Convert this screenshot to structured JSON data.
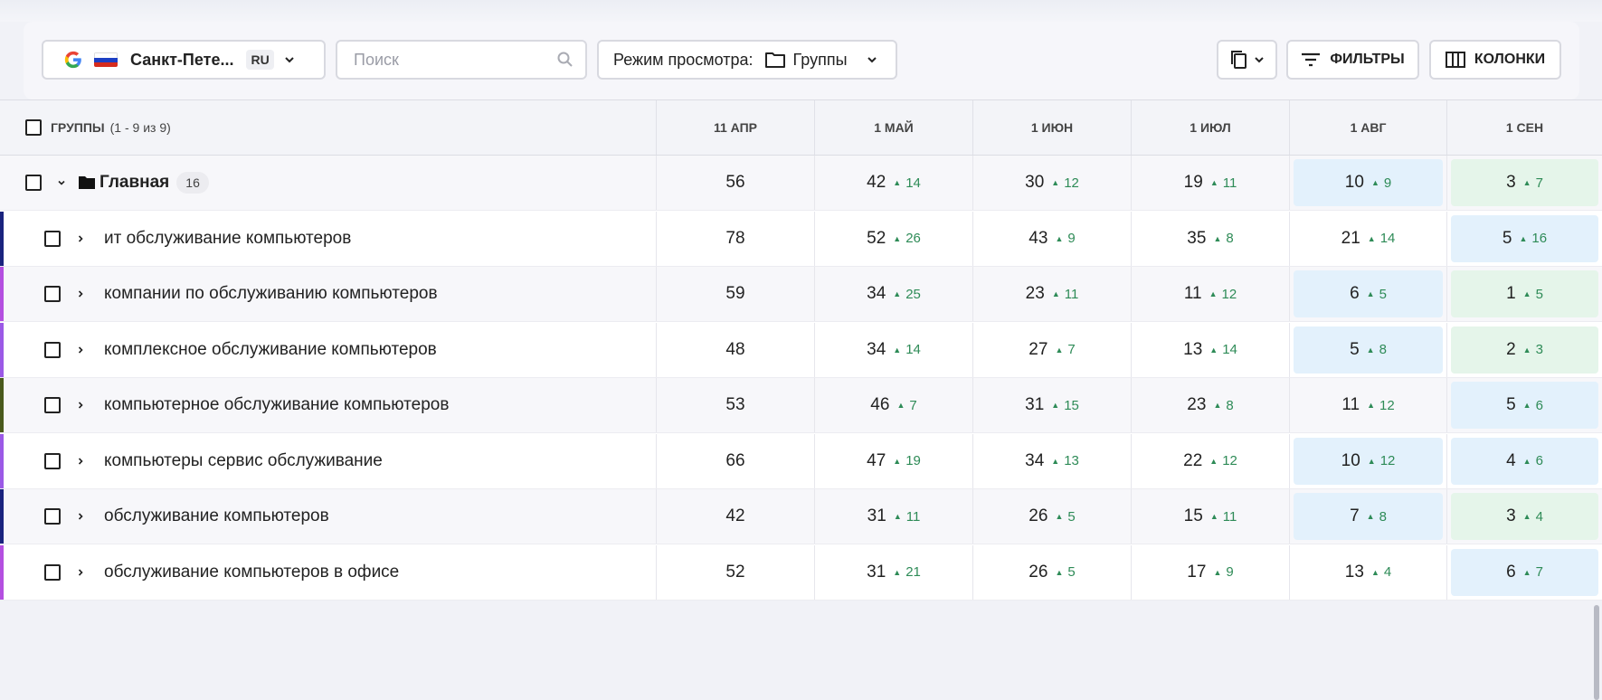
{
  "toolbar": {
    "region": "Санкт-Пете...",
    "language": "RU",
    "search_placeholder": "Поиск",
    "view_mode_label": "Режим просмотра:",
    "view_mode_value": "Группы",
    "filters_label": "ФИЛЬТРЫ",
    "columns_label": "КОЛОНКИ"
  },
  "table": {
    "groups_header": "ГРУППЫ",
    "groups_count": "(1 - 9 из 9)",
    "columns": [
      "11 АПР",
      "1 МАЙ",
      "1 ИЮН",
      "1 ИЮЛ",
      "1 АВГ",
      "1 СЕН"
    ],
    "group_row": {
      "name": "Главная",
      "badge": "16",
      "cells": [
        {
          "value": "56"
        },
        {
          "value": "42",
          "delta": "14"
        },
        {
          "value": "30",
          "delta": "12"
        },
        {
          "value": "19",
          "delta": "11"
        },
        {
          "value": "10",
          "delta": "9",
          "highlight": "blue"
        },
        {
          "value": "3",
          "delta": "7",
          "highlight": "green"
        }
      ]
    },
    "rows": [
      {
        "name": "ит обслуживание компьютеров",
        "bar": "#1a237e",
        "cells": [
          {
            "value": "78"
          },
          {
            "value": "52",
            "delta": "26"
          },
          {
            "value": "43",
            "delta": "9"
          },
          {
            "value": "35",
            "delta": "8"
          },
          {
            "value": "21",
            "delta": "14"
          },
          {
            "value": "5",
            "delta": "16",
            "highlight": "blue"
          }
        ]
      },
      {
        "name": "компании по обслуживанию компьютеров",
        "bar": "#b44fe0",
        "cells": [
          {
            "value": "59"
          },
          {
            "value": "34",
            "delta": "25"
          },
          {
            "value": "23",
            "delta": "11"
          },
          {
            "value": "11",
            "delta": "12"
          },
          {
            "value": "6",
            "delta": "5",
            "highlight": "blue"
          },
          {
            "value": "1",
            "delta": "5",
            "highlight": "green"
          }
        ]
      },
      {
        "name": "комплексное обслуживание компьютеров",
        "bar": "#9b59e6",
        "cells": [
          {
            "value": "48"
          },
          {
            "value": "34",
            "delta": "14"
          },
          {
            "value": "27",
            "delta": "7"
          },
          {
            "value": "13",
            "delta": "14"
          },
          {
            "value": "5",
            "delta": "8",
            "highlight": "blue"
          },
          {
            "value": "2",
            "delta": "3",
            "highlight": "green"
          }
        ]
      },
      {
        "name": "компьютерное обслуживание компьютеров",
        "bar": "#4a5a1c",
        "cells": [
          {
            "value": "53"
          },
          {
            "value": "46",
            "delta": "7"
          },
          {
            "value": "31",
            "delta": "15"
          },
          {
            "value": "23",
            "delta": "8"
          },
          {
            "value": "11",
            "delta": "12"
          },
          {
            "value": "5",
            "delta": "6",
            "highlight": "blue"
          }
        ]
      },
      {
        "name": "компьютеры сервис обслуживание",
        "bar": "#9b59e6",
        "cells": [
          {
            "value": "66"
          },
          {
            "value": "47",
            "delta": "19"
          },
          {
            "value": "34",
            "delta": "13"
          },
          {
            "value": "22",
            "delta": "12"
          },
          {
            "value": "10",
            "delta": "12",
            "highlight": "blue"
          },
          {
            "value": "4",
            "delta": "6",
            "highlight": "blue"
          }
        ]
      },
      {
        "name": "обслуживание компьютеров",
        "bar": "#1a237e",
        "cells": [
          {
            "value": "42"
          },
          {
            "value": "31",
            "delta": "11"
          },
          {
            "value": "26",
            "delta": "5"
          },
          {
            "value": "15",
            "delta": "11"
          },
          {
            "value": "7",
            "delta": "8",
            "highlight": "blue"
          },
          {
            "value": "3",
            "delta": "4",
            "highlight": "green"
          }
        ]
      },
      {
        "name": "обслуживание компьютеров в офисе",
        "bar": "#b44fe0",
        "cells": [
          {
            "value": "52"
          },
          {
            "value": "31",
            "delta": "21"
          },
          {
            "value": "26",
            "delta": "5"
          },
          {
            "value": "17",
            "delta": "9"
          },
          {
            "value": "13",
            "delta": "4"
          },
          {
            "value": "6",
            "delta": "7",
            "highlight": "blue"
          }
        ]
      }
    ]
  }
}
